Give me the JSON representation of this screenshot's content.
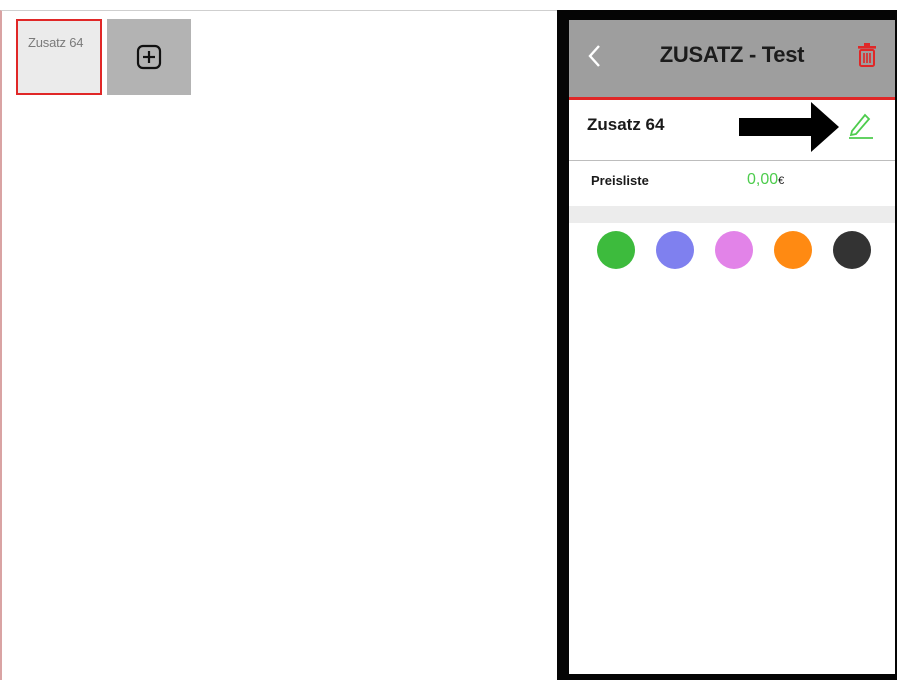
{
  "left": {
    "tile_label": "Zusatz 64"
  },
  "panel": {
    "title": "ZUSATZ - Test",
    "name": "Zusatz 64",
    "price_label": "Preisliste",
    "price_value": "0,00",
    "price_currency": "€"
  },
  "icons": {
    "add": "plus-square-icon",
    "back": "chevron-left-icon",
    "delete": "trash-icon",
    "edit": "pencil-icon",
    "annotation": "arrow-right-icon"
  },
  "colors": {
    "accent_red": "#e02727",
    "price_green": "#4dcc4d",
    "swatches": [
      "#3dbb3d",
      "#7f80ef",
      "#e283e8",
      "#ff8a12",
      "#333333"
    ]
  }
}
